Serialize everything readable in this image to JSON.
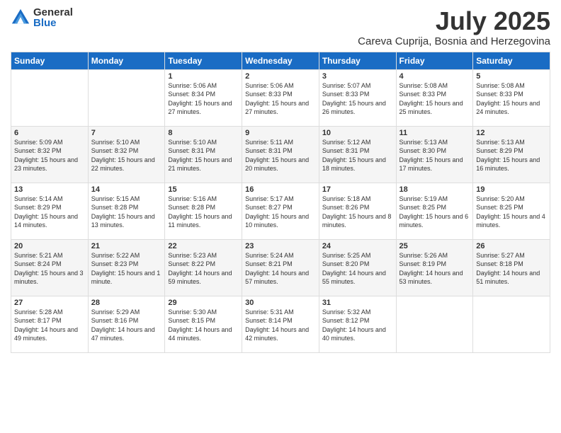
{
  "logo": {
    "general": "General",
    "blue": "Blue"
  },
  "title": "July 2025",
  "subtitle": "Careva Cuprija, Bosnia and Herzegovina",
  "weekdays": [
    "Sunday",
    "Monday",
    "Tuesday",
    "Wednesday",
    "Thursday",
    "Friday",
    "Saturday"
  ],
  "weeks": [
    [
      {
        "day": null,
        "info": null
      },
      {
        "day": null,
        "info": null
      },
      {
        "day": "1",
        "info": "Sunrise: 5:06 AM\nSunset: 8:34 PM\nDaylight: 15 hours and 27 minutes."
      },
      {
        "day": "2",
        "info": "Sunrise: 5:06 AM\nSunset: 8:33 PM\nDaylight: 15 hours and 27 minutes."
      },
      {
        "day": "3",
        "info": "Sunrise: 5:07 AM\nSunset: 8:33 PM\nDaylight: 15 hours and 26 minutes."
      },
      {
        "day": "4",
        "info": "Sunrise: 5:08 AM\nSunset: 8:33 PM\nDaylight: 15 hours and 25 minutes."
      },
      {
        "day": "5",
        "info": "Sunrise: 5:08 AM\nSunset: 8:33 PM\nDaylight: 15 hours and 24 minutes."
      }
    ],
    [
      {
        "day": "6",
        "info": "Sunrise: 5:09 AM\nSunset: 8:32 PM\nDaylight: 15 hours and 23 minutes."
      },
      {
        "day": "7",
        "info": "Sunrise: 5:10 AM\nSunset: 8:32 PM\nDaylight: 15 hours and 22 minutes."
      },
      {
        "day": "8",
        "info": "Sunrise: 5:10 AM\nSunset: 8:31 PM\nDaylight: 15 hours and 21 minutes."
      },
      {
        "day": "9",
        "info": "Sunrise: 5:11 AM\nSunset: 8:31 PM\nDaylight: 15 hours and 20 minutes."
      },
      {
        "day": "10",
        "info": "Sunrise: 5:12 AM\nSunset: 8:31 PM\nDaylight: 15 hours and 18 minutes."
      },
      {
        "day": "11",
        "info": "Sunrise: 5:13 AM\nSunset: 8:30 PM\nDaylight: 15 hours and 17 minutes."
      },
      {
        "day": "12",
        "info": "Sunrise: 5:13 AM\nSunset: 8:29 PM\nDaylight: 15 hours and 16 minutes."
      }
    ],
    [
      {
        "day": "13",
        "info": "Sunrise: 5:14 AM\nSunset: 8:29 PM\nDaylight: 15 hours and 14 minutes."
      },
      {
        "day": "14",
        "info": "Sunrise: 5:15 AM\nSunset: 8:28 PM\nDaylight: 15 hours and 13 minutes."
      },
      {
        "day": "15",
        "info": "Sunrise: 5:16 AM\nSunset: 8:28 PM\nDaylight: 15 hours and 11 minutes."
      },
      {
        "day": "16",
        "info": "Sunrise: 5:17 AM\nSunset: 8:27 PM\nDaylight: 15 hours and 10 minutes."
      },
      {
        "day": "17",
        "info": "Sunrise: 5:18 AM\nSunset: 8:26 PM\nDaylight: 15 hours and 8 minutes."
      },
      {
        "day": "18",
        "info": "Sunrise: 5:19 AM\nSunset: 8:25 PM\nDaylight: 15 hours and 6 minutes."
      },
      {
        "day": "19",
        "info": "Sunrise: 5:20 AM\nSunset: 8:25 PM\nDaylight: 15 hours and 4 minutes."
      }
    ],
    [
      {
        "day": "20",
        "info": "Sunrise: 5:21 AM\nSunset: 8:24 PM\nDaylight: 15 hours and 3 minutes."
      },
      {
        "day": "21",
        "info": "Sunrise: 5:22 AM\nSunset: 8:23 PM\nDaylight: 15 hours and 1 minute."
      },
      {
        "day": "22",
        "info": "Sunrise: 5:23 AM\nSunset: 8:22 PM\nDaylight: 14 hours and 59 minutes."
      },
      {
        "day": "23",
        "info": "Sunrise: 5:24 AM\nSunset: 8:21 PM\nDaylight: 14 hours and 57 minutes."
      },
      {
        "day": "24",
        "info": "Sunrise: 5:25 AM\nSunset: 8:20 PM\nDaylight: 14 hours and 55 minutes."
      },
      {
        "day": "25",
        "info": "Sunrise: 5:26 AM\nSunset: 8:19 PM\nDaylight: 14 hours and 53 minutes."
      },
      {
        "day": "26",
        "info": "Sunrise: 5:27 AM\nSunset: 8:18 PM\nDaylight: 14 hours and 51 minutes."
      }
    ],
    [
      {
        "day": "27",
        "info": "Sunrise: 5:28 AM\nSunset: 8:17 PM\nDaylight: 14 hours and 49 minutes."
      },
      {
        "day": "28",
        "info": "Sunrise: 5:29 AM\nSunset: 8:16 PM\nDaylight: 14 hours and 47 minutes."
      },
      {
        "day": "29",
        "info": "Sunrise: 5:30 AM\nSunset: 8:15 PM\nDaylight: 14 hours and 44 minutes."
      },
      {
        "day": "30",
        "info": "Sunrise: 5:31 AM\nSunset: 8:14 PM\nDaylight: 14 hours and 42 minutes."
      },
      {
        "day": "31",
        "info": "Sunrise: 5:32 AM\nSunset: 8:12 PM\nDaylight: 14 hours and 40 minutes."
      },
      {
        "day": null,
        "info": null
      },
      {
        "day": null,
        "info": null
      }
    ]
  ]
}
